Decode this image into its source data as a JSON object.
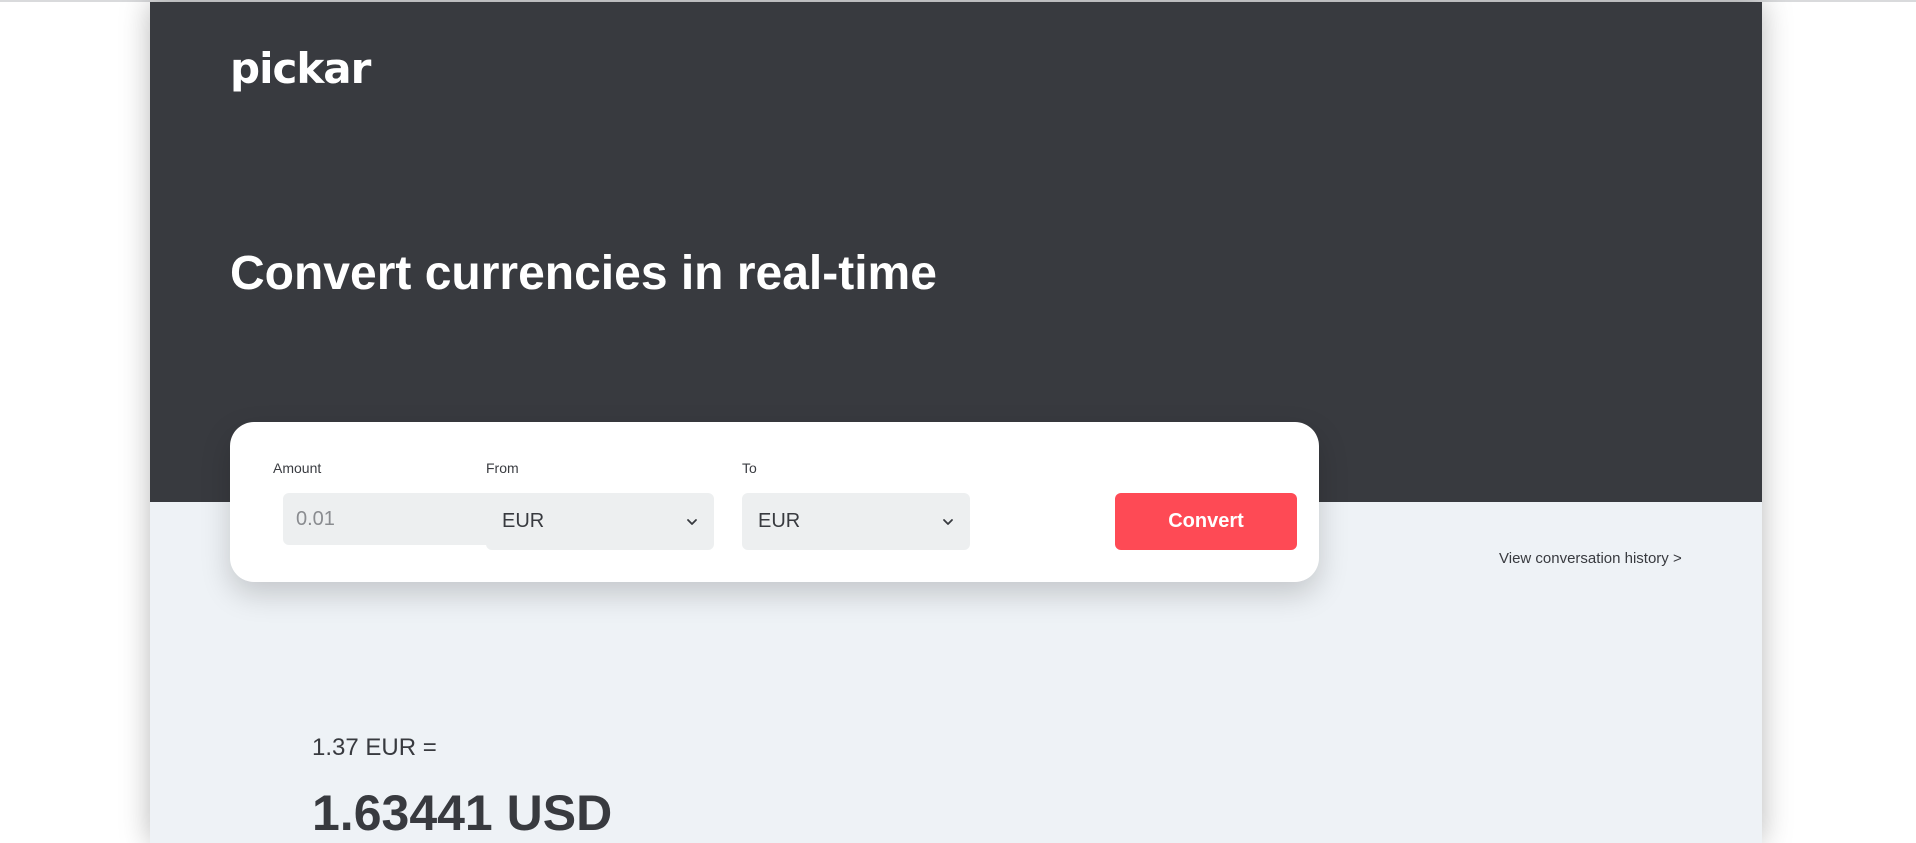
{
  "brand": {
    "logo_text": "pickar"
  },
  "hero": {
    "headline": "Convert currencies in real-time"
  },
  "converter": {
    "amount": {
      "label": "Amount",
      "placeholder": "0.01"
    },
    "from": {
      "label": "From",
      "selected": "EUR"
    },
    "swap": {
      "icon": "swap-arrows-icon"
    },
    "to": {
      "label": "To",
      "selected": "EUR"
    },
    "convert_label": "Convert"
  },
  "links": {
    "history": "View conversation history >"
  },
  "result": {
    "source": "1.37 EUR =",
    "converted": "1.63441 USD"
  },
  "colors": {
    "hero_bg": "#383a3f",
    "page_bg": "#eef2f6",
    "accent": "#fe4a55",
    "field_bg": "#edeff0"
  }
}
